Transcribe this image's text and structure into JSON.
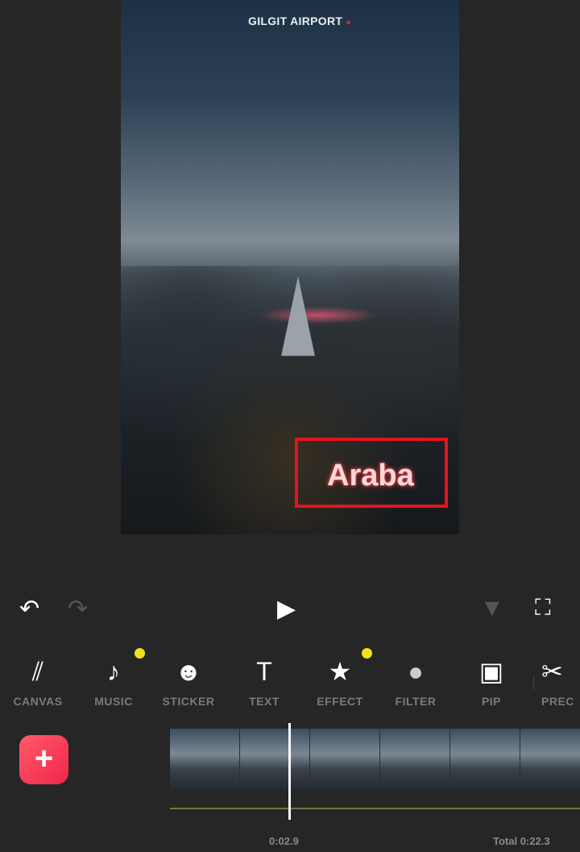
{
  "preview": {
    "location_text": "GILGIT AIRPORT",
    "pin_icon": "map-pin-icon",
    "overlay_text": "Araba",
    "selection_color": "#e3141e"
  },
  "controls": {
    "undo": "↶",
    "redo": "↷",
    "play": "▶",
    "keyframe": "▼",
    "fullscreen": "⛶"
  },
  "tools": [
    {
      "label": "CANVAS",
      "icon": "⫽",
      "dot": false
    },
    {
      "label": "MUSIC",
      "icon": "♪",
      "dot": true
    },
    {
      "label": "STICKER",
      "icon": "☻",
      "dot": false
    },
    {
      "label": "TEXT",
      "icon": "T",
      "dot": false
    },
    {
      "label": "EFFECT",
      "icon": "★",
      "dot": true
    },
    {
      "label": "FILTER",
      "icon": "●",
      "dot": false
    },
    {
      "label": "PIP",
      "icon": "▣",
      "dot": false
    },
    {
      "label": "PREC",
      "icon": "✂",
      "dot": false
    }
  ],
  "timeline": {
    "add_label": "+",
    "current_time": "0:02.9",
    "total_time": "Total 0:22.3"
  },
  "colors": {
    "accent": "#f0264a",
    "dot": "#f1e21b"
  }
}
